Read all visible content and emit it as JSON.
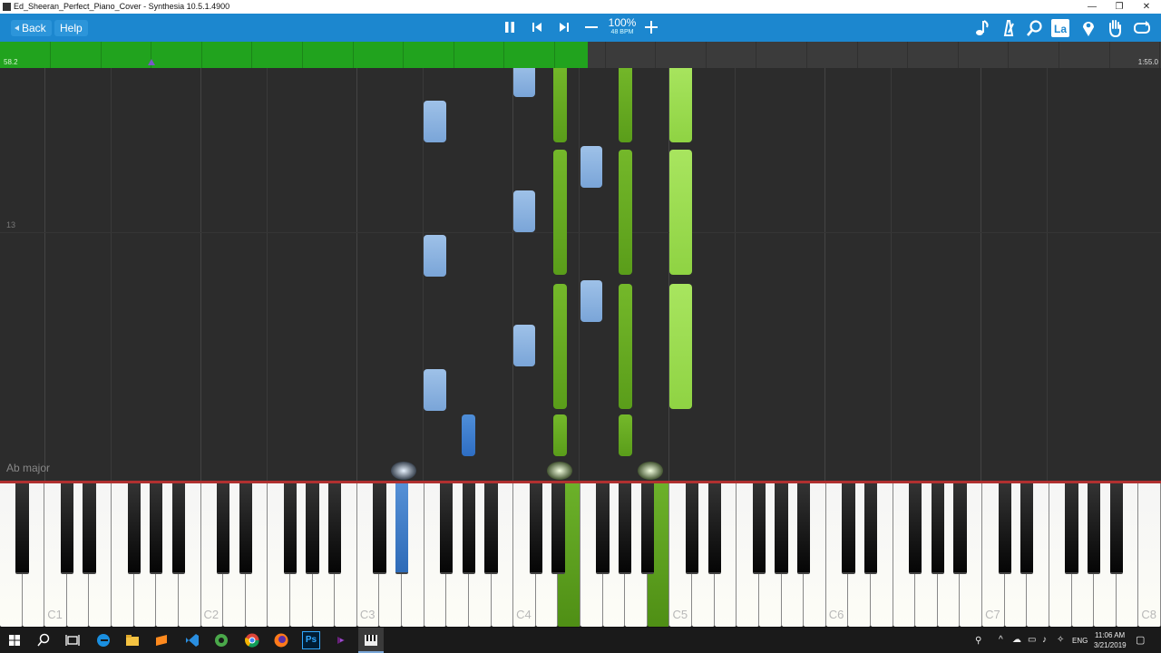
{
  "window": {
    "title": "Ed_Sheeran_Perfect_Piano_Cover - Synthesia 10.5.1.4900",
    "minimize_glyph": "—",
    "restore_glyph": "❐",
    "close_glyph": "✕"
  },
  "toolbar": {
    "back_label": "Back",
    "help_label": "Help",
    "zoom_percent": "100%",
    "tempo": "48 BPM",
    "icons": [
      "pause-icon",
      "skip-back-icon",
      "skip-forward-icon",
      "minus-icon",
      "plus-icon",
      "note-icon",
      "metronome-icon",
      "search-icon",
      "labels-icon",
      "location-icon",
      "hand-icon",
      "loop-icon"
    ],
    "labels_icon_text": "La"
  },
  "progress": {
    "position": "58.2",
    "length": "1:55.0",
    "fraction": 0.506
  },
  "notearea": {
    "measure_number": "13",
    "key_signature": "Ab major"
  },
  "keyboard": {
    "octave_labels": [
      "C1",
      "C2",
      "C3",
      "C4",
      "C5",
      "C6",
      "C7",
      "C8"
    ]
  },
  "colors": {
    "toolbar": "#1c87cf",
    "progress_fill": "#21a31e",
    "right_hand_light": "#a8e55f",
    "right_hand_dark": "#6cb12a",
    "left_hand_light": "#9ec1e8",
    "left_hand_dark": "#4f8ed8"
  },
  "taskbar": {
    "icons": [
      "windows-start-icon",
      "search-icon",
      "task-view-icon",
      "edge-icon",
      "file-explorer-icon",
      "vscode-icon",
      "app-icon",
      "sublime-icon",
      "chrome-icon",
      "firefox-icon",
      "photoshop-icon",
      "visual-studio-icon",
      "synthesia-icon"
    ],
    "photoshop_text": "Ps",
    "language": "ENG",
    "time": "11:06 AM",
    "date": "3/21/2019"
  }
}
